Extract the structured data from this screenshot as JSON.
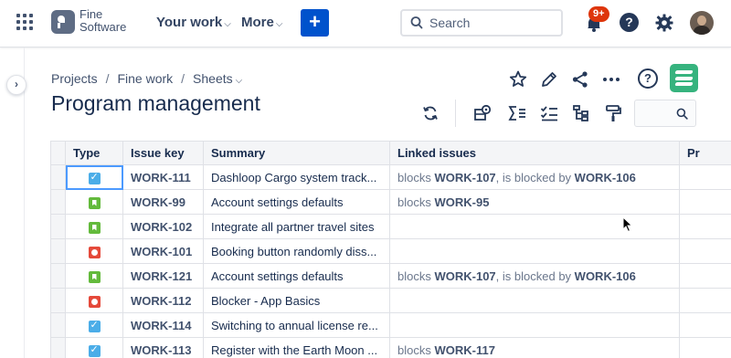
{
  "nav": {
    "brand_line1": "Fine",
    "brand_line2": "Software",
    "your_work": "Your work",
    "more": "More",
    "create": "+",
    "search_placeholder": "Search",
    "notifications_badge": "9+"
  },
  "breadcrumb": {
    "projects": "Projects",
    "sep1": "/",
    "project": "Fine work",
    "sep2": "/",
    "sheets": "Sheets"
  },
  "page_title": "Program management",
  "table": {
    "columns": [
      "Type",
      "Issue key",
      "Summary",
      "Linked issues",
      "Pr"
    ],
    "rows": [
      {
        "type": "task",
        "key": "WORK-111",
        "summary": "Dashloop Cargo system track...",
        "linked": [
          {
            "rel": "blocks",
            "key": "WORK-107"
          },
          {
            "rel": ", is blocked by",
            "key": "WORK-106"
          }
        ]
      },
      {
        "type": "story",
        "key": "WORK-99",
        "summary": "Account settings defaults",
        "linked": [
          {
            "rel": "blocks",
            "key": "WORK-95"
          }
        ]
      },
      {
        "type": "story",
        "key": "WORK-102",
        "summary": "Integrate all partner travel sites",
        "linked": []
      },
      {
        "type": "bug",
        "key": "WORK-101",
        "summary": "Booking button randomly diss...",
        "linked": []
      },
      {
        "type": "story",
        "key": "WORK-121",
        "summary": "Account settings defaults",
        "linked": [
          {
            "rel": "blocks",
            "key": "WORK-107"
          },
          {
            "rel": ", is blocked by",
            "key": "WORK-106"
          }
        ]
      },
      {
        "type": "bug",
        "key": "WORK-112",
        "summary": "Blocker - App Basics",
        "linked": []
      },
      {
        "type": "task",
        "key": "WORK-114",
        "summary": "Switching to annual license re...",
        "linked": []
      },
      {
        "type": "task",
        "key": "WORK-113",
        "summary": "Register with the Earth Moon ...",
        "linked": [
          {
            "rel": "blocks",
            "key": "WORK-117"
          }
        ]
      }
    ]
  },
  "colors": {
    "primary": "#0052cc",
    "task": "#4bade8",
    "story": "#63ba3c",
    "bug": "#e5493a",
    "app_logo": "#36b37e",
    "badge": "#de350b"
  }
}
